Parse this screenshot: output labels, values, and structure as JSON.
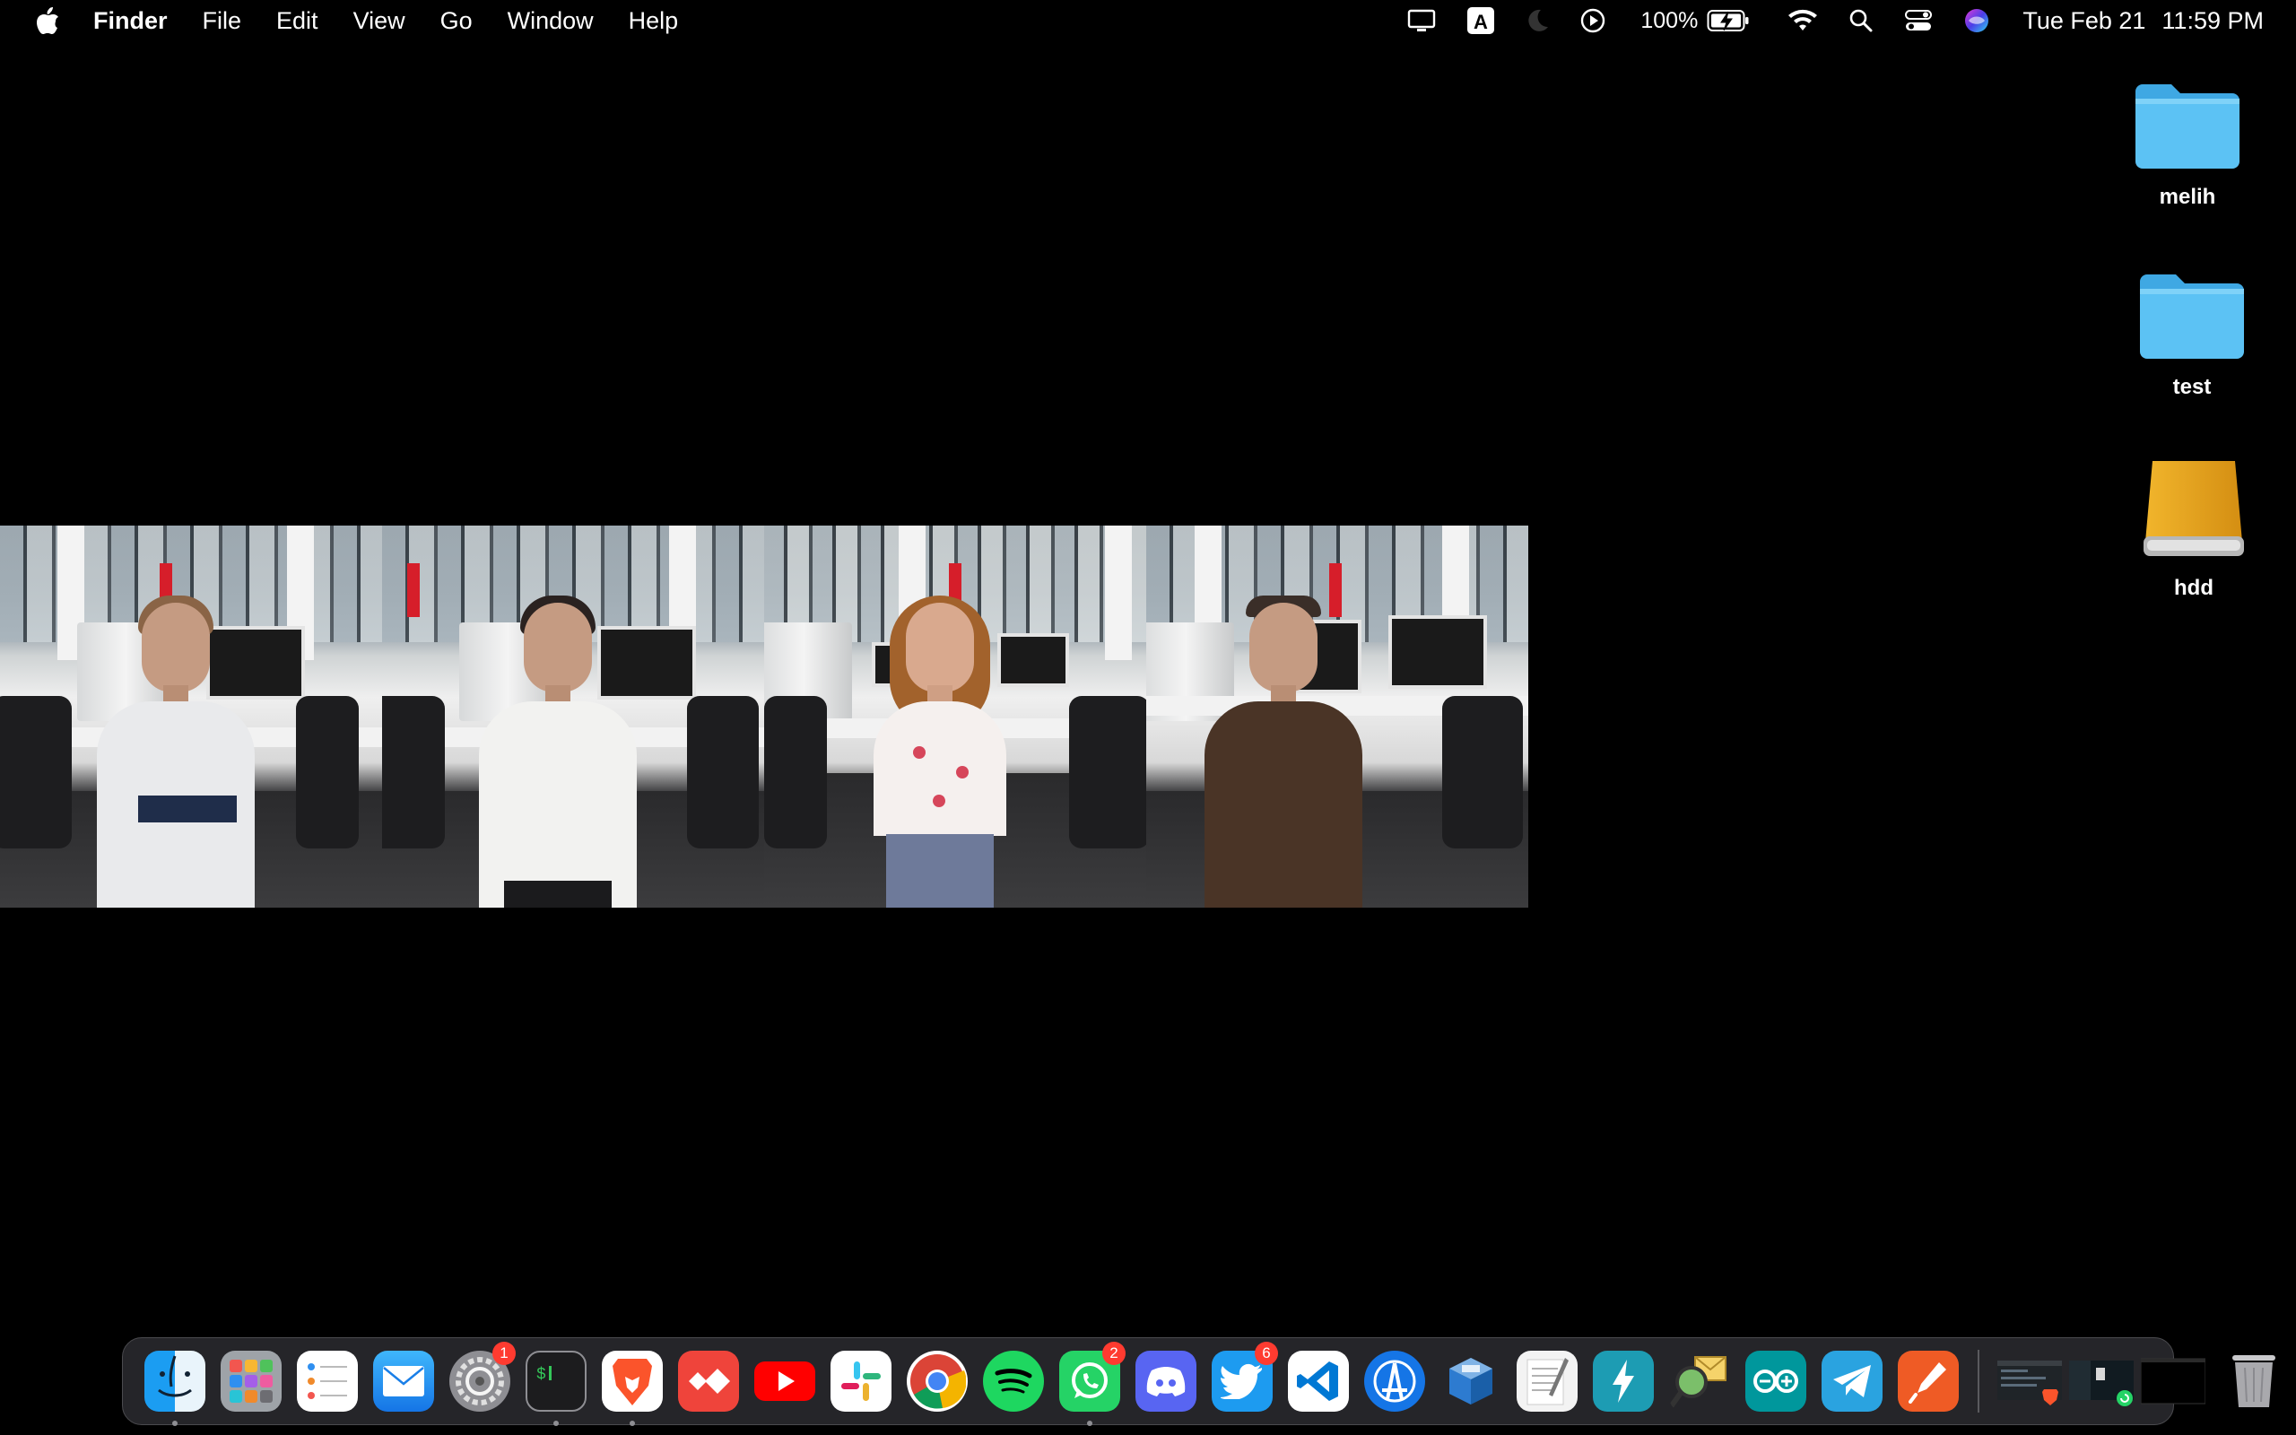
{
  "menubar": {
    "apple_icon": "apple-logo",
    "app_name": "Finder",
    "menus": [
      "File",
      "Edit",
      "View",
      "Go",
      "Window",
      "Help"
    ],
    "status_icons": [
      "display-icon",
      "input-source-A-icon",
      "focus-moon-icon",
      "now-playing-icon"
    ],
    "battery_percent": "100%",
    "battery_state": "charging",
    "clock_date": "Tue Feb 21",
    "clock_time": "11:59 PM"
  },
  "desktop": {
    "icons": [
      {
        "label": "melih",
        "kind": "folder",
        "color": "#4ab6ee"
      },
      {
        "label": "test",
        "kind": "folder",
        "color": "#4ab6ee"
      },
      {
        "label": "hdd",
        "kind": "external-drive",
        "color": "#e4a321"
      }
    ]
  },
  "photo_strip": {
    "panels": [
      {
        "subject": "man-white-tshirt",
        "shirt_color": "#e9eaec",
        "hair_color": "#8a6446"
      },
      {
        "subject": "man-white-polo",
        "shirt_color": "#f2f2f0",
        "hair_color": "#2a2220"
      },
      {
        "subject": "woman-floral-top",
        "shirt_color": "#f5f0ee",
        "hair_color": "#a2622c"
      },
      {
        "subject": "man-brown-tshirt",
        "shirt_color": "#4a3426",
        "hair_color": "#3a2e28"
      }
    ]
  },
  "dock": {
    "apps": [
      {
        "name": "Finder",
        "icon": "finder-icon",
        "running": true
      },
      {
        "name": "Launchpad",
        "icon": "launchpad-icon",
        "running": false
      },
      {
        "name": "Reminders",
        "icon": "reminders-icon",
        "running": false
      },
      {
        "name": "Mail",
        "icon": "mail-icon",
        "running": false
      },
      {
        "name": "System Preferences",
        "icon": "system-preferences-icon",
        "running": false,
        "badge": "1"
      },
      {
        "name": "Terminal",
        "icon": "terminal-icon",
        "running": true
      },
      {
        "name": "Brave Browser",
        "icon": "brave-icon",
        "running": true
      },
      {
        "name": "AnyDesk",
        "icon": "anydesk-icon",
        "running": false
      },
      {
        "name": "YouTube",
        "icon": "youtube-icon",
        "running": false
      },
      {
        "name": "Slack",
        "icon": "slack-icon",
        "running": false
      },
      {
        "name": "Google Chrome",
        "icon": "chrome-icon",
        "running": false
      },
      {
        "name": "Spotify",
        "icon": "spotify-icon",
        "running": false
      },
      {
        "name": "WhatsApp",
        "icon": "whatsapp-icon",
        "running": true,
        "badge": "2"
      },
      {
        "name": "Discord",
        "icon": "discord-icon",
        "running": false
      },
      {
        "name": "Twitter",
        "icon": "twitter-icon",
        "running": false,
        "badge": "6"
      },
      {
        "name": "Visual Studio Code",
        "icon": "vscode-icon",
        "running": false
      },
      {
        "name": "Xcode Instruments",
        "icon": "instruments-icon",
        "running": false
      },
      {
        "name": "VirtualBox",
        "icon": "virtualbox-icon",
        "running": false
      },
      {
        "name": "TextEdit",
        "icon": "textedit-icon",
        "running": false
      },
      {
        "name": "Electron",
        "icon": "bolt-app-icon",
        "running": false
      },
      {
        "name": "Mail Scanner",
        "icon": "magnifier-mail-icon",
        "running": false
      },
      {
        "name": "Arduino",
        "icon": "arduino-icon",
        "running": false
      },
      {
        "name": "Telegram",
        "icon": "telegram-icon",
        "running": false
      },
      {
        "name": "Postman",
        "icon": "postman-icon",
        "running": false
      }
    ],
    "minimized_windows": [
      "brave-window-thumbnail",
      "whatsapp-window-thumbnail",
      "black-window-thumbnail"
    ],
    "trash_icon": "trash-icon"
  }
}
